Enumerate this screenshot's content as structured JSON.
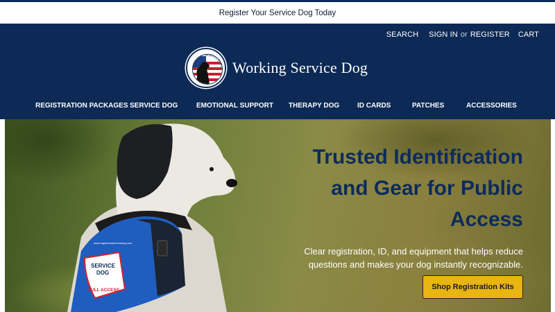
{
  "announcement": "Register Your Service Dog Today",
  "utility_nav": {
    "search": "SEARCH",
    "sign_in": "SIGN IN",
    "or": "or",
    "register": "REGISTER",
    "cart": "CART"
  },
  "logo": {
    "seal_text": "WORKING SERVICE DOG",
    "wordmark": "Working Service Dog"
  },
  "main_nav": [
    "REGISTRATION PACKAGES",
    "SERVICE DOG",
    "EMOTIONAL SUPPORT",
    "THERAPY DOG",
    "ID CARDS",
    "PATCHES",
    "ACCESSORIES"
  ],
  "hero": {
    "title_line1": "Trusted Identification",
    "title_line2": "and Gear for Public",
    "title_line3": "Access",
    "subtitle_line1": "Clear registration, ID, and equipment that helps reduce",
    "subtitle_line2": "questions and makes your dog instantly recognizable.",
    "cta_label": "Shop Registration Kits",
    "vest_patch": {
      "line1": "SERVICE",
      "line2": "DOG",
      "line3": "FULL ACCESS",
      "url": "www.registeredservicedog.com"
    }
  },
  "colors": {
    "navy": "#0c2a55",
    "title_navy": "#0d2b5a",
    "cta_gold": "#e8b511",
    "vest_blue": "#1f5dbf"
  }
}
